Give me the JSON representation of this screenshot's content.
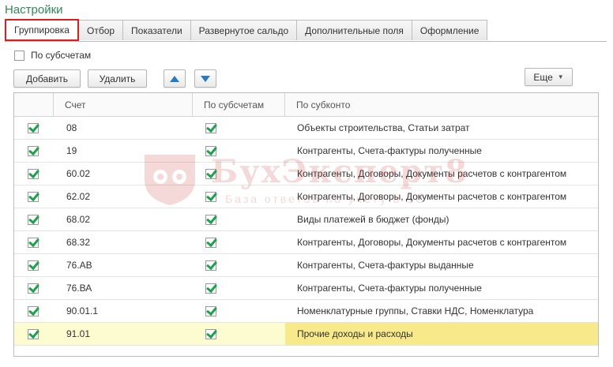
{
  "title": "Настройки",
  "tabs": [
    {
      "label": "Группировка",
      "active": true
    },
    {
      "label": "Отбор"
    },
    {
      "label": "Показатели"
    },
    {
      "label": "Развернутое сальдо"
    },
    {
      "label": "Дополнительные поля"
    },
    {
      "label": "Оформление"
    }
  ],
  "subaccounts_label": "По субсчетам",
  "toolbar": {
    "add_label": "Добавить",
    "delete_label": "Удалить",
    "more_label": "Еще"
  },
  "grid": {
    "columns": [
      "",
      "Счет",
      "По субсчетам",
      "По субконто"
    ],
    "rows": [
      {
        "account": "08",
        "subconto": "Объекты строительства, Статьи затрат"
      },
      {
        "account": "19",
        "subconto": "Контрагенты, Счета-фактуры полученные"
      },
      {
        "account": "60.02",
        "subconto": "Контрагенты, Договоры, Документы расчетов с контрагентом"
      },
      {
        "account": "62.02",
        "subconto": "Контрагенты, Договоры, Документы расчетов с контрагентом"
      },
      {
        "account": "68.02",
        "subconto": "Виды платежей в бюджет (фонды)"
      },
      {
        "account": "68.32",
        "subconto": "Контрагенты, Договоры, Документы расчетов с контрагентом"
      },
      {
        "account": "76.АВ",
        "subconto": "Контрагенты, Счета-фактуры выданные"
      },
      {
        "account": "76.ВА",
        "subconto": "Контрагенты, Счета-фактуры полученные"
      },
      {
        "account": "90.01.1",
        "subconto": "Номенклатурные группы, Ставки НДС, Номенклатура"
      },
      {
        "account": "91.01",
        "subconto": "Прочие доходы и расходы",
        "selected": true
      }
    ]
  },
  "watermark": {
    "text": "БухЭксперт8",
    "sub": "База ответов по учету в 1С"
  },
  "colors": {
    "title": "#2e8b57",
    "active_tab_border": "#e01c1c",
    "check": "#1aa34a",
    "arrow": "#2a78c5",
    "selected_row": "#fdfbd0",
    "selected_cell": "#f8e98a"
  }
}
